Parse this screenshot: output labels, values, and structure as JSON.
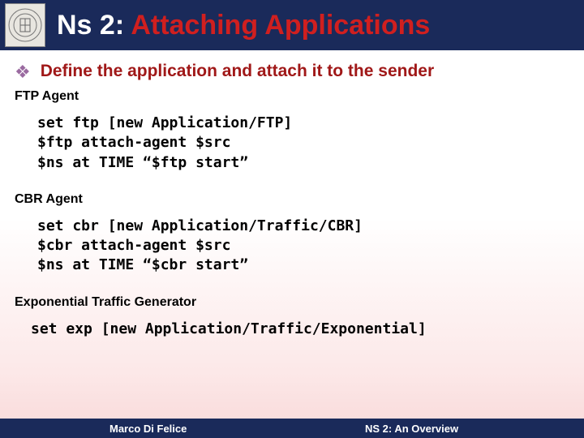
{
  "header": {
    "title_part1": "Ns 2: ",
    "title_part2": "Attaching Applications"
  },
  "content": {
    "bullet": "Define the application and attach it to the sender",
    "sections": [
      {
        "label": "FTP Agent",
        "code": "set ftp [new Application/FTP]\n$ftp attach-agent $src\n$ns at TIME “$ftp start”"
      },
      {
        "label": "CBR Agent",
        "code": "set cbr [new Application/Traffic/CBR]\n$cbr attach-agent $src\n$ns at TIME “$cbr start”"
      },
      {
        "label": "Exponential Traffic Generator",
        "code": "set exp [new Application/Traffic/Exponential]"
      }
    ]
  },
  "footer": {
    "left": "Marco Di Felice",
    "right": "NS 2: An Overview"
  }
}
